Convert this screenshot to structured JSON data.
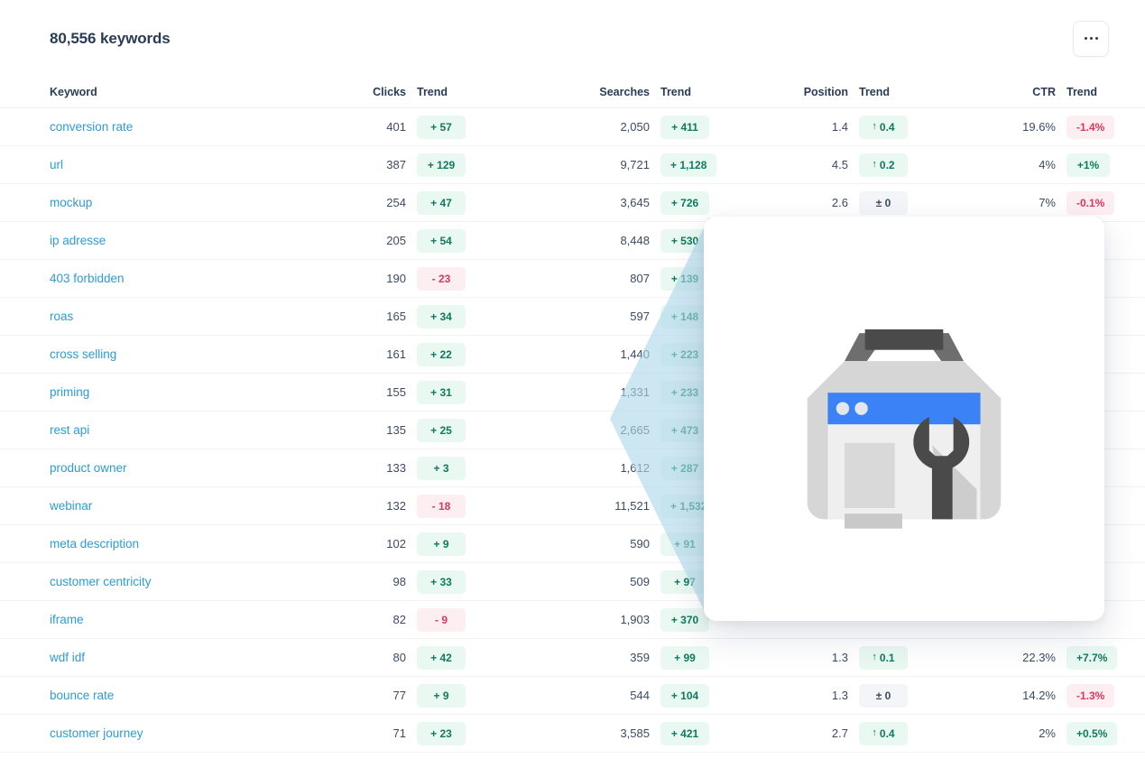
{
  "header": {
    "title": "80,556 keywords",
    "more_label": "More options",
    "more_icon": "ellipsis-horizontal-icon"
  },
  "table": {
    "columns": [
      {
        "key": "keyword",
        "label": "Keyword",
        "align": "left"
      },
      {
        "key": "clicks",
        "label": "Clicks",
        "align": "right"
      },
      {
        "key": "ctrend",
        "label": "Trend",
        "align": "left"
      },
      {
        "key": "searches",
        "label": "Searches",
        "align": "right"
      },
      {
        "key": "strend",
        "label": "Trend",
        "align": "left"
      },
      {
        "key": "position",
        "label": "Position",
        "align": "right"
      },
      {
        "key": "ptrend",
        "label": "Trend",
        "align": "left"
      },
      {
        "key": "ctr",
        "label": "CTR",
        "align": "right"
      },
      {
        "key": "ttrend",
        "label": "Trend",
        "align": "left"
      }
    ],
    "rows": [
      {
        "keyword": "conversion rate",
        "clicks": "401",
        "clicks_trend": {
          "text": "+ 57",
          "dir": "up"
        },
        "searches": "2,050",
        "searches_trend": {
          "text": "+ 411",
          "dir": "up"
        },
        "position": "1.4",
        "position_trend": {
          "text": "0.4",
          "dir": "up",
          "arrow": "↑"
        },
        "ctr": "19.6%",
        "ctr_trend": {
          "text": "-1.4%",
          "dir": "down"
        }
      },
      {
        "keyword": "url",
        "clicks": "387",
        "clicks_trend": {
          "text": "+ 129",
          "dir": "up"
        },
        "searches": "9,721",
        "searches_trend": {
          "text": "+ 1,128",
          "dir": "up"
        },
        "position": "4.5",
        "position_trend": {
          "text": "0.2",
          "dir": "up",
          "arrow": "↑"
        },
        "ctr": "4%",
        "ctr_trend": {
          "text": "+1%",
          "dir": "up"
        }
      },
      {
        "keyword": "mockup",
        "clicks": "254",
        "clicks_trend": {
          "text": "+ 47",
          "dir": "up"
        },
        "searches": "3,645",
        "searches_trend": {
          "text": "+ 726",
          "dir": "up"
        },
        "position": "2.6",
        "position_trend": {
          "text": "± 0",
          "dir": "flat"
        },
        "ctr": "7%",
        "ctr_trend": {
          "text": "-0.1%",
          "dir": "down"
        }
      },
      {
        "keyword": "ip adresse",
        "clicks": "205",
        "clicks_trend": {
          "text": "+ 54",
          "dir": "up"
        },
        "searches": "8,448",
        "searches_trend": {
          "text": "+ 530",
          "dir": "up"
        },
        "position": "",
        "position_trend": null,
        "ctr": "",
        "ctr_trend": null
      },
      {
        "keyword": "403 forbidden",
        "clicks": "190",
        "clicks_trend": {
          "text": "- 23",
          "dir": "down"
        },
        "searches": "807",
        "searches_trend": {
          "text": "+ 139",
          "dir": "up"
        },
        "position": "",
        "position_trend": null,
        "ctr": "",
        "ctr_trend": null
      },
      {
        "keyword": "roas",
        "clicks": "165",
        "clicks_trend": {
          "text": "+ 34",
          "dir": "up"
        },
        "searches": "597",
        "searches_trend": {
          "text": "+ 148",
          "dir": "up"
        },
        "position": "",
        "position_trend": null,
        "ctr": "",
        "ctr_trend": null
      },
      {
        "keyword": "cross selling",
        "clicks": "161",
        "clicks_trend": {
          "text": "+ 22",
          "dir": "up"
        },
        "searches": "1,440",
        "searches_trend": {
          "text": "+ 223",
          "dir": "up"
        },
        "position": "",
        "position_trend": null,
        "ctr": "",
        "ctr_trend": null
      },
      {
        "keyword": "priming",
        "clicks": "155",
        "clicks_trend": {
          "text": "+ 31",
          "dir": "up"
        },
        "searches": "1,331",
        "searches_trend": {
          "text": "+ 233",
          "dir": "up"
        },
        "position": "",
        "position_trend": null,
        "ctr": "",
        "ctr_trend": null
      },
      {
        "keyword": "rest api",
        "clicks": "135",
        "clicks_trend": {
          "text": "+ 25",
          "dir": "up"
        },
        "searches": "2,665",
        "searches_trend": {
          "text": "+ 473",
          "dir": "up"
        },
        "position": "",
        "position_trend": null,
        "ctr": "",
        "ctr_trend": null
      },
      {
        "keyword": "product owner",
        "clicks": "133",
        "clicks_trend": {
          "text": "+ 3",
          "dir": "up"
        },
        "searches": "1,612",
        "searches_trend": {
          "text": "+ 287",
          "dir": "up"
        },
        "position": "",
        "position_trend": null,
        "ctr": "",
        "ctr_trend": null
      },
      {
        "keyword": "webinar",
        "clicks": "132",
        "clicks_trend": {
          "text": "- 18",
          "dir": "down"
        },
        "searches": "11,521",
        "searches_trend": {
          "text": "+ 1,532",
          "dir": "up"
        },
        "position": "",
        "position_trend": null,
        "ctr": "",
        "ctr_trend": null
      },
      {
        "keyword": "meta description",
        "clicks": "102",
        "clicks_trend": {
          "text": "+ 9",
          "dir": "up"
        },
        "searches": "590",
        "searches_trend": {
          "text": "+ 91",
          "dir": "up"
        },
        "position": "",
        "position_trend": null,
        "ctr": "",
        "ctr_trend": null
      },
      {
        "keyword": "customer centricity",
        "clicks": "98",
        "clicks_trend": {
          "text": "+ 33",
          "dir": "up"
        },
        "searches": "509",
        "searches_trend": {
          "text": "+ 97",
          "dir": "up"
        },
        "position": "",
        "position_trend": null,
        "ctr": "",
        "ctr_trend": null
      },
      {
        "keyword": "iframe",
        "clicks": "82",
        "clicks_trend": {
          "text": "- 9",
          "dir": "down"
        },
        "searches": "1,903",
        "searches_trend": {
          "text": "+ 370",
          "dir": "up"
        },
        "position": "",
        "position_trend": null,
        "ctr": "",
        "ctr_trend": null
      },
      {
        "keyword": "wdf idf",
        "clicks": "80",
        "clicks_trend": {
          "text": "+ 42",
          "dir": "up"
        },
        "searches": "359",
        "searches_trend": {
          "text": "+ 99",
          "dir": "up"
        },
        "position": "1.3",
        "position_trend": {
          "text": "0.1",
          "dir": "up",
          "arrow": "↑"
        },
        "ctr": "22.3%",
        "ctr_trend": {
          "text": "+7.7%",
          "dir": "up"
        }
      },
      {
        "keyword": "bounce rate",
        "clicks": "77",
        "clicks_trend": {
          "text": "+ 9",
          "dir": "up"
        },
        "searches": "544",
        "searches_trend": {
          "text": "+ 104",
          "dir": "up"
        },
        "position": "1.3",
        "position_trend": {
          "text": "± 0",
          "dir": "flat"
        },
        "ctr": "14.2%",
        "ctr_trend": {
          "text": "-1.3%",
          "dir": "down"
        }
      },
      {
        "keyword": "customer journey",
        "clicks": "71",
        "clicks_trend": {
          "text": "+ 23",
          "dir": "up"
        },
        "searches": "3,585",
        "searches_trend": {
          "text": "+ 421",
          "dir": "up"
        },
        "position": "2.7",
        "position_trend": {
          "text": "0.4",
          "dir": "up",
          "arrow": "↑"
        },
        "ctr": "2%",
        "ctr_trend": {
          "text": "+0.5%",
          "dir": "up"
        }
      }
    ]
  },
  "overlay": {
    "wedge_color": "#aed8ea",
    "popup_name": "keyword-preview-popup",
    "illustration": "seo-toolbox-icon"
  },
  "colors": {
    "link": "#2e9bd6",
    "text": "#2c3e57",
    "badge_up_bg": "#e9f8f1",
    "badge_up_text": "#0f7a5d",
    "badge_down_bg": "#fdeef1",
    "badge_down_text": "#d83a5e",
    "badge_flat_bg": "#f3f5f9",
    "badge_flat_text": "#3c4a63",
    "illu_blue": "#3b82f6",
    "illu_dark": "#4a4a4a",
    "illu_grey": "#d6d6d6"
  }
}
